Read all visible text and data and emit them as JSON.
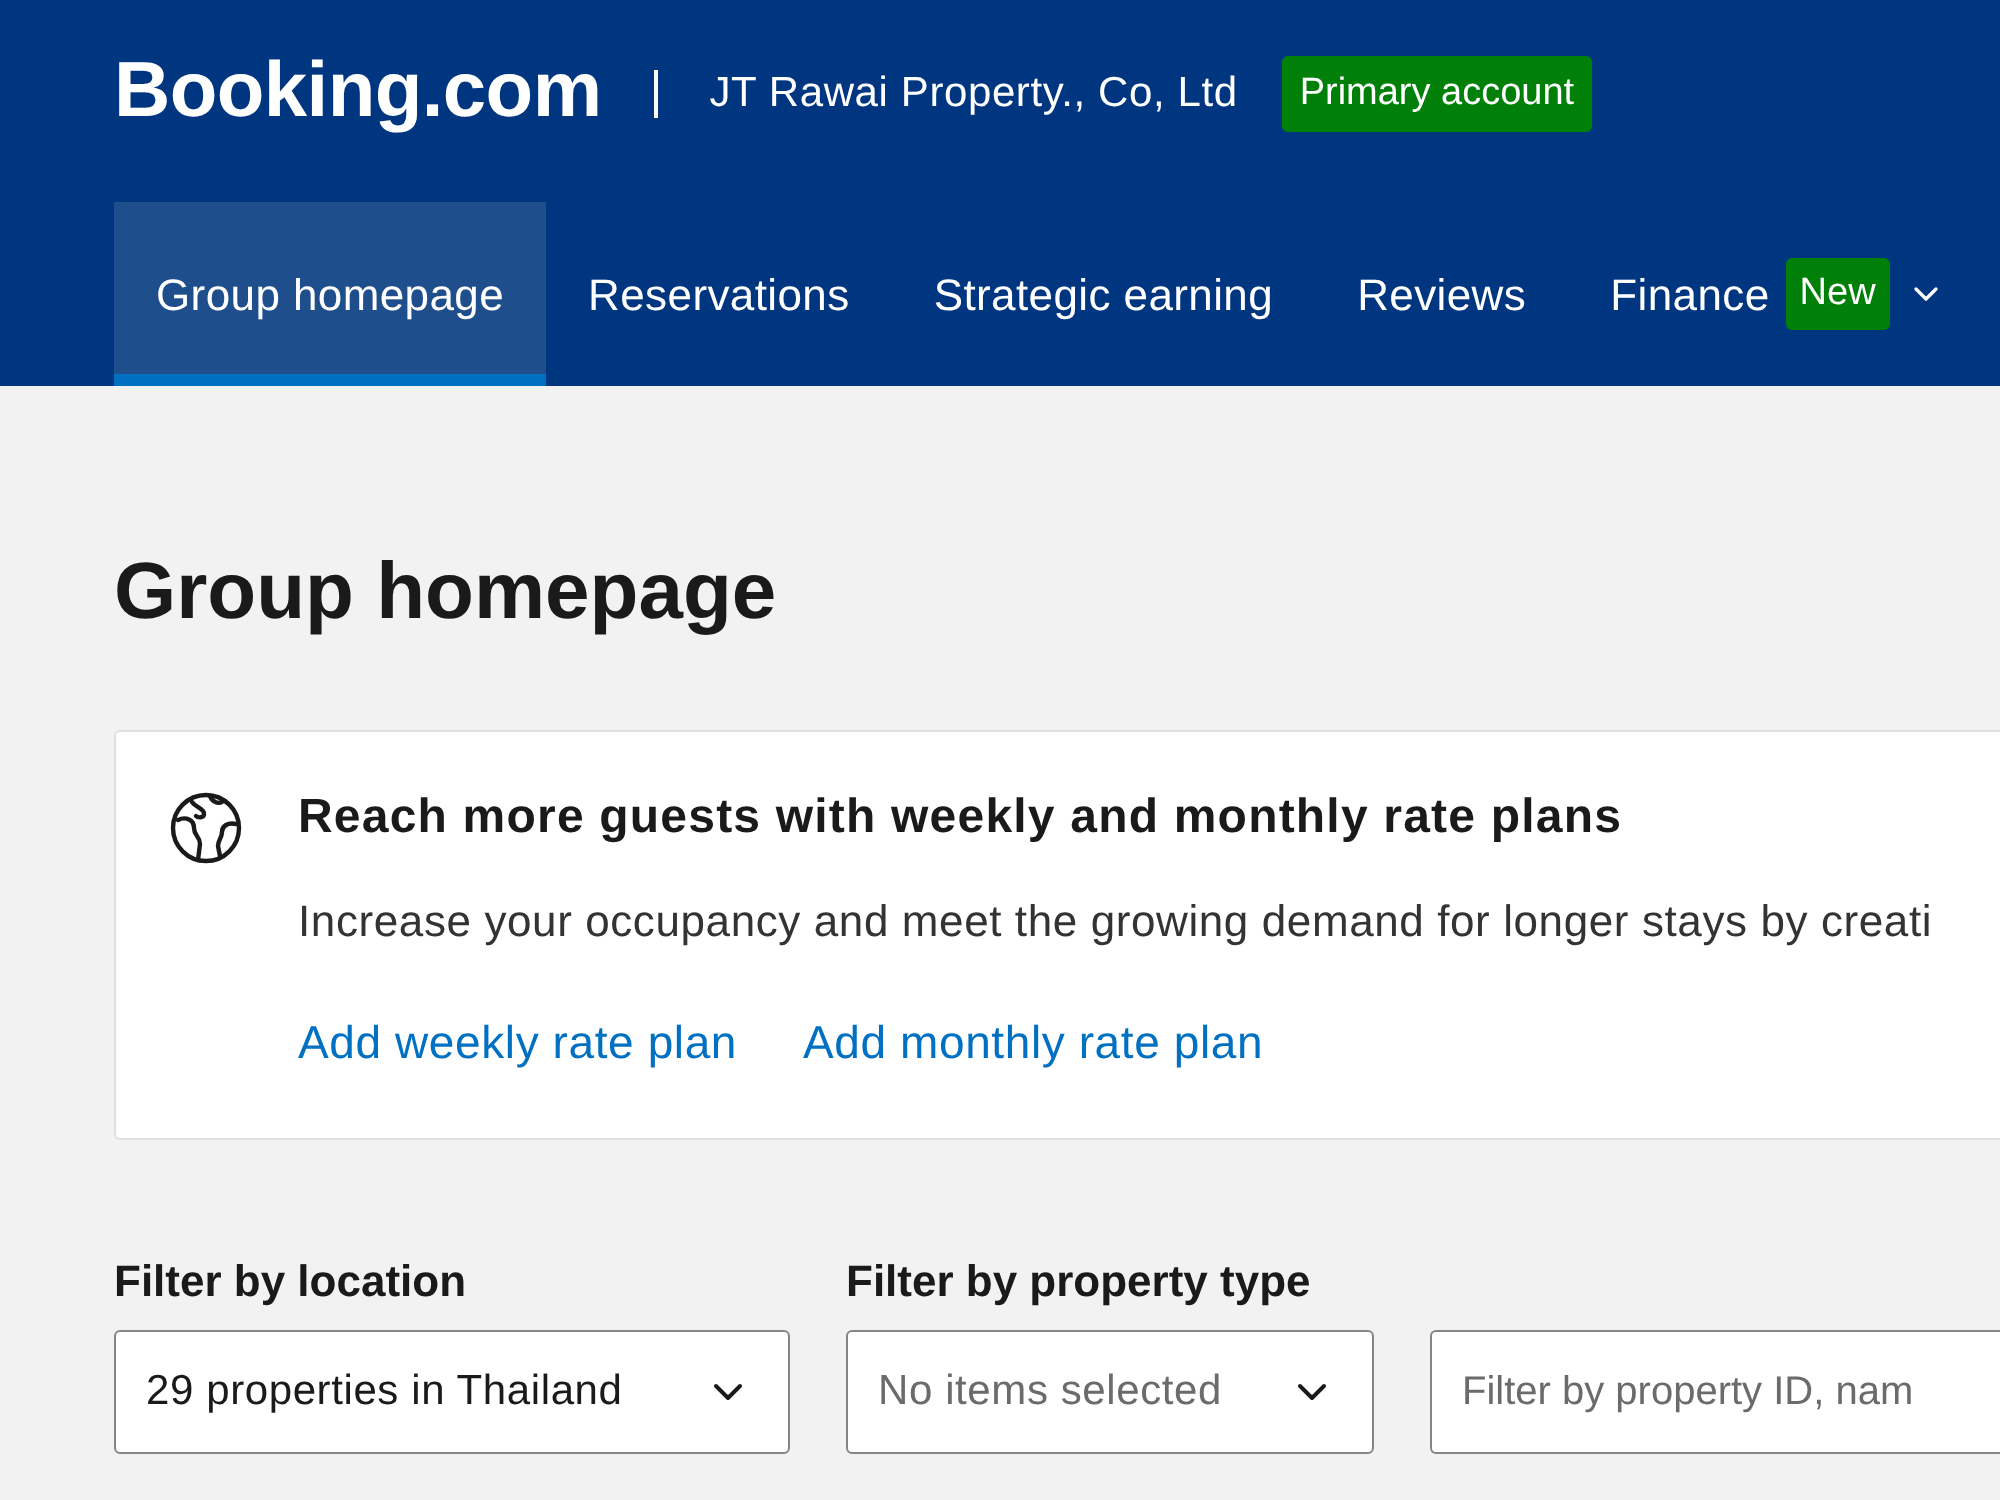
{
  "header": {
    "logo": "Booking.com",
    "account_name": "JT Rawai Property., Co, Ltd",
    "account_badge": "Primary account"
  },
  "nav": {
    "tabs": [
      {
        "label": "Group homepage",
        "selected": true
      },
      {
        "label": "Reservations",
        "selected": false
      },
      {
        "label": "Strategic earning",
        "selected": false
      },
      {
        "label": "Reviews",
        "selected": false
      },
      {
        "label": "Finance",
        "selected": false,
        "badge": "New",
        "has_menu": true
      }
    ]
  },
  "page_title": "Group homepage",
  "promo_card": {
    "title": "Reach more guests with weekly and monthly rate plans",
    "description": "Increase your occupancy and meet the growing demand for longer stays by creati",
    "links": [
      "Add weekly rate plan",
      "Add monthly rate plan"
    ]
  },
  "filters": [
    {
      "kind": "dropdown",
      "label": "Filter by location",
      "value": "29 properties in Thailand"
    },
    {
      "kind": "dropdown",
      "label": "Filter by property type",
      "placeholder": "No items selected"
    },
    {
      "kind": "search",
      "placeholder": "Filter by property ID, nam"
    }
  ]
}
